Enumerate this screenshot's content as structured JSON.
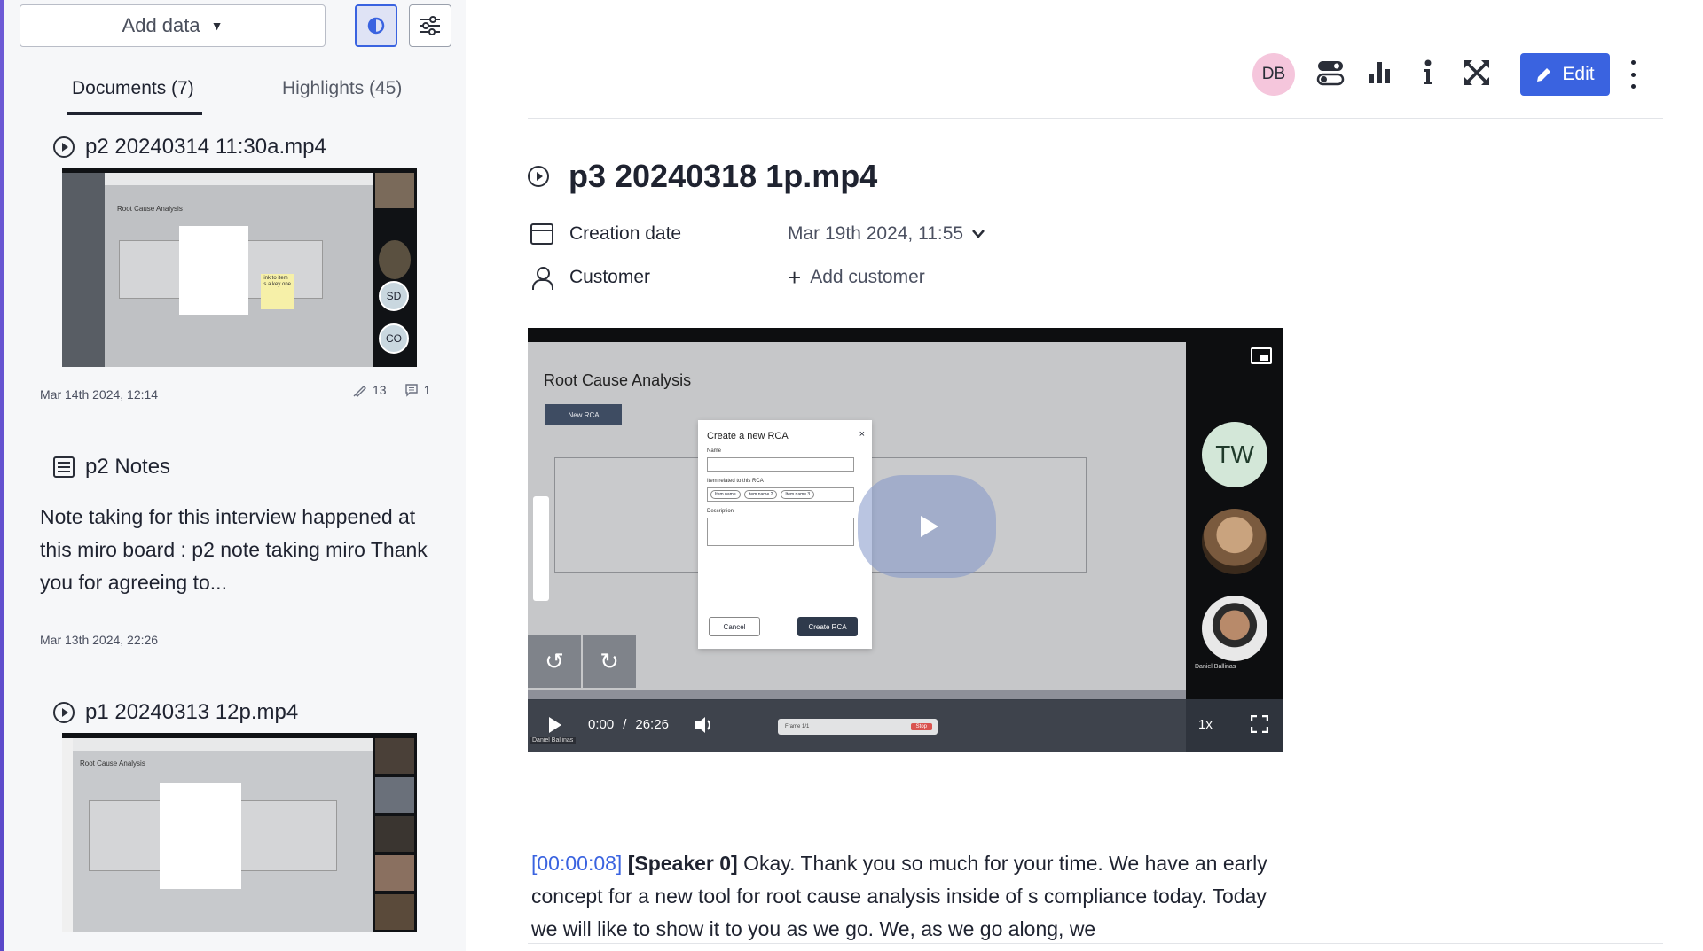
{
  "sidebar": {
    "add_data_label": "Add data",
    "tabs": [
      {
        "label": "Documents (7)",
        "active": true
      },
      {
        "label": "Highlights (45)",
        "active": false
      }
    ],
    "documents": [
      {
        "title": "p2 20240314 11:30a.mp4",
        "date": "Mar 14th 2024, 12:14",
        "highlights_count": "13",
        "comments_count": "1",
        "thumb_avatars": [
          "SD",
          "CO"
        ],
        "thumb_heading": "Root Cause Analysis",
        "thumb_sticky": "link to item is a key one"
      },
      {
        "title": "p2 Notes",
        "note": "Note taking for this interview happened at this miro board : p2 note taking miro Thank you for agreeing to...",
        "date": "Mar 13th 2024, 22:26"
      },
      {
        "title": "p1 20240313 12p.mp4",
        "thumb_heading": "Root Cause Analysis"
      }
    ]
  },
  "header": {
    "avatar_initials": "DB",
    "edit_label": "Edit",
    "accent_color": "#3a63e0"
  },
  "main": {
    "title": "p3 20240318 1p.mp4",
    "properties": [
      {
        "label": "Creation date",
        "value": "Mar 19th 2024, 11:55"
      },
      {
        "label": "Customer",
        "value": "Add customer"
      }
    ]
  },
  "video": {
    "screen_heading": "Root Cause Analysis",
    "new_button": "New RCA",
    "modal": {
      "title": "Create a new RCA",
      "name_label": "Name",
      "items_label": "Item related to this RCA",
      "chips": [
        "Item name",
        "Item name 2",
        "Item name 3"
      ],
      "description_label": "Description",
      "cancel": "Cancel",
      "create": "Create RCA"
    },
    "participants": [
      "TW"
    ],
    "participant_name": "Daniel Ballinas",
    "current_time": "0:00",
    "separator": "/",
    "duration": "26:26",
    "speed": "1x",
    "progress": 0.0,
    "frame_label": "Frame 1/1",
    "stop_label": "Stop"
  },
  "transcript": {
    "timestamp": "[00:00:08]",
    "speaker": "[Speaker 0]",
    "text": " Okay. Thank you so much for your time. We have an early concept for a new tool for root cause analysis inside of s compliance today. Today we will like to show it to you as we go. We, as we go along, we"
  }
}
